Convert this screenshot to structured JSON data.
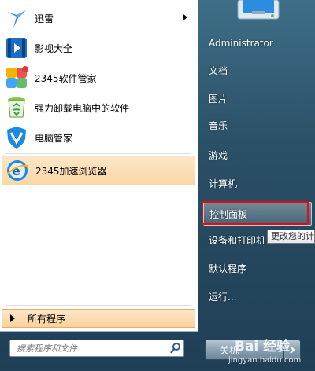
{
  "programs": [
    {
      "label": "迅雷",
      "icon": "xunlei-bird-icon",
      "has_submenu": true
    },
    {
      "label": "影视大全",
      "icon": "video-film-icon",
      "has_submenu": false
    },
    {
      "label": "2345软件管家",
      "icon": "software-manager-icon",
      "has_submenu": false
    },
    {
      "label": "强力卸载电脑中的软件",
      "icon": "recycle-uninstall-icon",
      "has_submenu": false
    },
    {
      "label": "电脑管家",
      "icon": "shield-v-icon",
      "has_submenu": false
    },
    {
      "label": "2345加速浏览器",
      "icon": "browser-e-icon",
      "has_submenu": false,
      "highlighted": true
    }
  ],
  "all_programs_label": "所有程序",
  "search": {
    "placeholder": "搜索程序和文件"
  },
  "right_items": [
    {
      "label": "Administrator"
    },
    {
      "label": "文档"
    },
    {
      "label": "图片"
    },
    {
      "label": "音乐"
    },
    {
      "label": "游戏"
    },
    {
      "label": "计算机"
    },
    {
      "label": "控制面板",
      "highlighted": true
    },
    {
      "label": "设备和打印机"
    },
    {
      "label": "默认程序"
    },
    {
      "label": "运行..."
    }
  ],
  "tooltip": "更改您的计",
  "shutdown_label": "关机",
  "watermark": {
    "main": "Bai 经验",
    "sub": "jingyan.baidu.com"
  },
  "colors": {
    "highlight": "#fbd7a7",
    "red_box": "#e10d14",
    "panel_bg": "#2a4f66"
  }
}
